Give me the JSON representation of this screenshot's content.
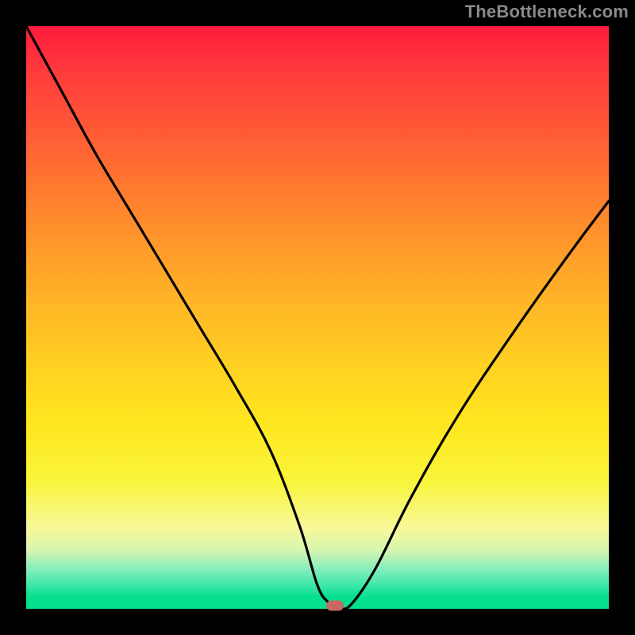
{
  "watermark": "TheBottleneck.com",
  "colors": {
    "frame": "#000000",
    "watermark": "#8a8a8a",
    "curve": "#000000",
    "marker": "#c76a62"
  },
  "chart_data": {
    "type": "line",
    "title": "",
    "xlabel": "",
    "ylabel": "",
    "xlim": [
      0,
      100
    ],
    "ylim": [
      0,
      100
    ],
    "grid": false,
    "legend": false,
    "background": "red-to-green vertical gradient",
    "series": [
      {
        "name": "bottleneck-curve",
        "x": [
          0,
          6,
          12,
          18,
          24,
          30,
          36,
          42,
          47,
          50,
          52,
          54,
          56,
          60,
          66,
          74,
          84,
          94,
          100
        ],
        "y": [
          100,
          89,
          78,
          68,
          58,
          48,
          38,
          27,
          14,
          4,
          1,
          0,
          1,
          7,
          19,
          33,
          48,
          62,
          70
        ]
      }
    ],
    "marker": {
      "x": 53,
      "y": 0.5
    }
  }
}
